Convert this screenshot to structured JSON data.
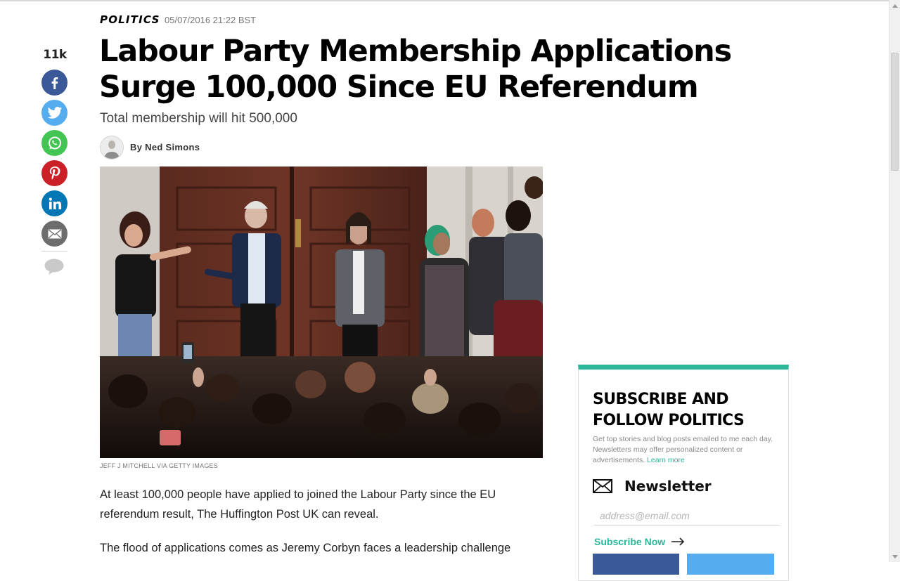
{
  "article": {
    "section": "POLITICS",
    "timestamp": "05/07/2016 21:22 BST",
    "headline": "Labour Party Membership Applications Surge 100,000 Since EU Referendum",
    "subheadline": "Total membership will hit 500,000",
    "byline": "By Ned Simons",
    "photo_credit": "JEFF J MITCHELL VIA GETTY IMAGES",
    "paragraphs": [
      "At least 100,000 people have applied to joined the Labour Party since the EU referendum result, The Huffington Post UK can reveal.",
      "The flood of applications comes as Jeremy Corbyn faces a leadership challenge"
    ]
  },
  "share": {
    "count": "11k",
    "buttons": [
      {
        "network": "facebook",
        "icon": "facebook-icon",
        "color": "#3b5998"
      },
      {
        "network": "twitter",
        "icon": "twitter-icon",
        "color": "#55acee"
      },
      {
        "network": "whatsapp",
        "icon": "whatsapp-icon",
        "color": "#43c553"
      },
      {
        "network": "pinterest",
        "icon": "pinterest-icon",
        "color": "#cb2027"
      },
      {
        "network": "linkedin",
        "icon": "linkedin-icon",
        "color": "#0077b5"
      },
      {
        "network": "email",
        "icon": "mail-icon",
        "color": "#6d6d6d"
      }
    ],
    "comment_icon": "comment-icon"
  },
  "subscribe": {
    "title": "SUBSCRIBE AND FOLLOW POLITICS",
    "description": "Get top stories and blog posts emailed to me each day. Newsletters may offer personalized content or advertisements.",
    "learn_more": "Learn more",
    "newsletter_label": "Newsletter",
    "email_placeholder": "address@email.com",
    "button_label": "Subscribe Now",
    "accent_color": "#2bb69a"
  }
}
